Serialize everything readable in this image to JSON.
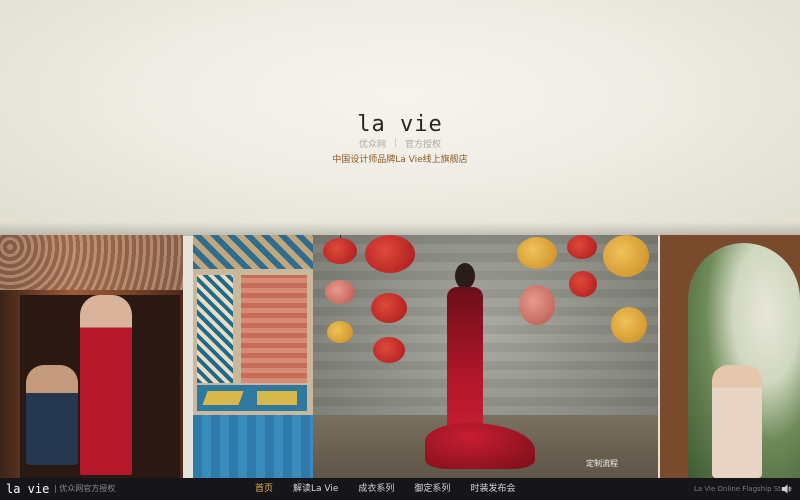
{
  "brand": {
    "logo_text": "la vie",
    "authorization": [
      "优众网",
      "官方授权"
    ],
    "separator": "|",
    "tagline": "中国设计师品牌La Vie线上旗舰店"
  },
  "footer": {
    "logo": "la vie",
    "auth_text": "| 优众网官方授权",
    "nav": [
      {
        "label": "首页",
        "active": true
      },
      {
        "label": "解读La Vie",
        "active": false
      },
      {
        "label": "成衣系列",
        "active": false
      },
      {
        "label": "御定系列",
        "active": false
      },
      {
        "label": "时装发布会",
        "active": false
      }
    ],
    "custom_process": "定制流程",
    "store_label": "La Vie Online Flagship Store",
    "sound_icon": "speaker-icon"
  },
  "colors": {
    "accent": "#e7b04a",
    "tagline": "#8a5a22",
    "footer_bg": "#16161a"
  }
}
